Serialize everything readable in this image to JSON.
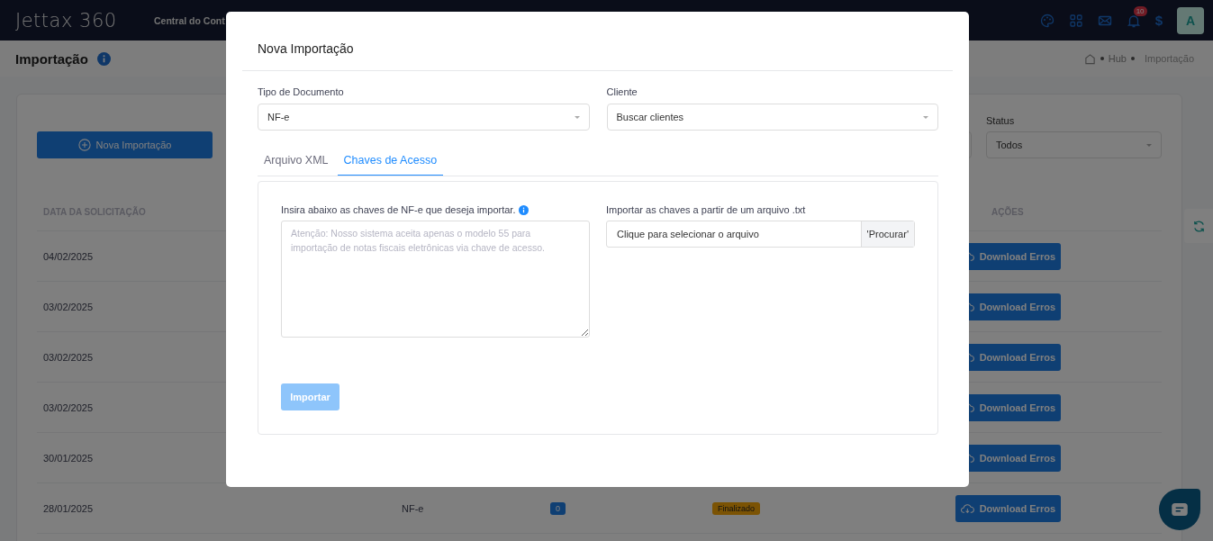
{
  "navbar": {
    "logo": "Jettax 360",
    "menu_item": "Central do Cont",
    "notification_count": "10",
    "currency_symbol": "$",
    "avatar_initial": "A"
  },
  "page": {
    "title": "Importação",
    "breadcrumb": [
      "Hub",
      "Importação"
    ]
  },
  "toolbar": {
    "new_button": "Nova Importação",
    "status_filter": {
      "label": "Status",
      "value": "Todos"
    }
  },
  "table": {
    "columns": [
      "DATA DA SOLICITAÇÃO",
      "AÇÕES"
    ],
    "rows": [
      {
        "date": "04/02/2025",
        "action": "Download Erros"
      },
      {
        "date": "03/02/2025",
        "action": "Download Erros"
      },
      {
        "date": "03/02/2025",
        "action": "Download Erros"
      },
      {
        "date": "03/02/2025",
        "action": "Download Erros"
      },
      {
        "date": "30/01/2025",
        "action": "Download Erros"
      },
      {
        "date": "28/01/2025",
        "type": "NF-e",
        "count": "0",
        "status": "Finalizado",
        "action": "Download Erros"
      }
    ]
  },
  "modal": {
    "title": "Nova Importação",
    "document_type": {
      "label": "Tipo de Documento",
      "value": "NF-e"
    },
    "client": {
      "label": "Cliente",
      "placeholder": "Buscar clientes"
    },
    "tabs": [
      {
        "label": "Arquivo XML",
        "selected": false
      },
      {
        "label": "Chaves de Acesso",
        "selected": true
      }
    ],
    "keys": {
      "label": "Insira abaixo as chaves de NF-e que deseja importar.",
      "placeholder": "Atenção: Nosso sistema aceita apenas o modelo 55 para importação de notas fiscais eletrônicas via chave de acesso."
    },
    "file": {
      "label": "Importar as chaves a partir de um arquivo .txt",
      "placeholder": "Clique para selecionar o arquivo",
      "browse": "'Procurar'"
    },
    "import_button": {
      "label": "Importar",
      "disabled": true
    }
  }
}
